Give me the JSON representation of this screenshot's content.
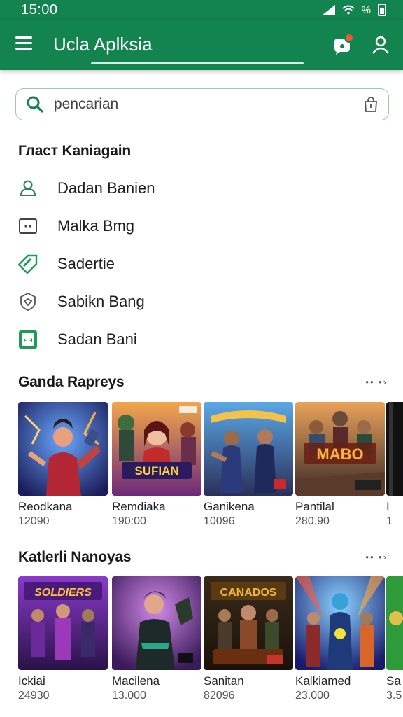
{
  "status": {
    "time": "15:00",
    "indicators": "⁴ᴳ ◢ ◠%"
  },
  "appbar": {
    "title": "Ucla Aplksia"
  },
  "search": {
    "placeholder": "pencarian"
  },
  "categories": {
    "title": "Гласт Kaniagain",
    "items": [
      {
        "label": "Dadan Banien",
        "icon": "user-outline-icon"
      },
      {
        "label": "Malka Bmg",
        "icon": "card-icon"
      },
      {
        "label": "Sadertie",
        "icon": "tag-icon"
      },
      {
        "label": "Sabikn Bang",
        "icon": "shield-icon"
      },
      {
        "label": "Sadan Bani",
        "icon": "face-icon"
      }
    ]
  },
  "games": {
    "title": "Ganda Rapreys",
    "more": "•• •›",
    "items": [
      {
        "name": "Reodkana",
        "value": "12090",
        "art": "heroine-icon"
      },
      {
        "name": "Remdiaka",
        "value": "190:00",
        "art": "sufian-poster",
        "poster_text": "SUFIAN"
      },
      {
        "name": "Ganikena",
        "value": "10096",
        "art": "warriors-poster"
      },
      {
        "name": "Pantilal",
        "value": "280.90",
        "art": "mabo-poster",
        "poster_text": "MABO"
      },
      {
        "name": "I",
        "value": "1",
        "art": "partial-poster"
      }
    ]
  },
  "katerlist": {
    "title": "Katlerli Nanoyas",
    "more": "•• •›",
    "items": [
      {
        "name": "Ickiai",
        "value": "24930",
        "art": "soldiers-poster",
        "poster_text": "SOLDIERS"
      },
      {
        "name": "Macilena",
        "value": "13.000",
        "art": "fighter-poster"
      },
      {
        "name": "Sanitan",
        "value": "82096",
        "art": "canados-poster",
        "poster_text": "CANADOS"
      },
      {
        "name": "Kalkiamed",
        "value": "23.000",
        "art": "heroes-poster"
      },
      {
        "name": "Sa",
        "value": "3.5",
        "art": "partial-poster-2"
      }
    ]
  },
  "colors": {
    "brand": "#13834f",
    "accent": "#e85b3a"
  }
}
